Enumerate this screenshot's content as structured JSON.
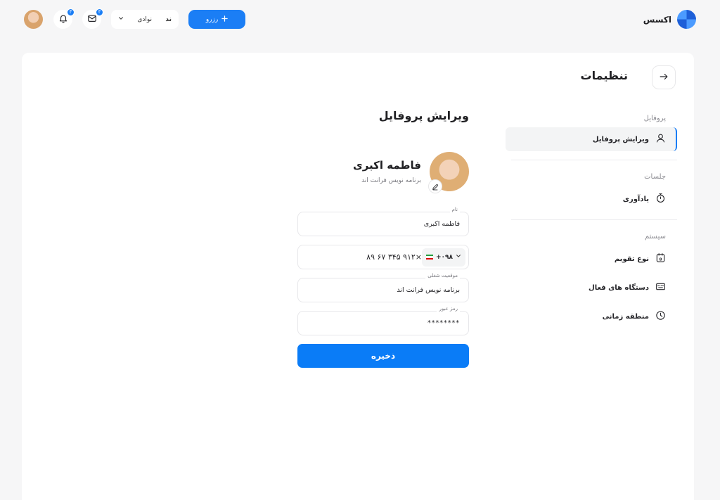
{
  "app": {
    "brand_name": "اکسس"
  },
  "topbar": {
    "reserve_label": "رزرو",
    "language": {
      "tag": "ﻧﺪ",
      "label": "نوادی"
    },
    "messages_badge": "۳",
    "notifications_badge": "۳"
  },
  "page": {
    "title": "تنظیمات"
  },
  "sidebar": {
    "sections": [
      {
        "title": "پروفایل",
        "items": [
          {
            "label": "ویرایش پروفایل",
            "icon": "user-icon"
          }
        ]
      },
      {
        "title": "جلسات",
        "items": [
          {
            "label": "یادآوری",
            "icon": "stopwatch-icon"
          }
        ]
      },
      {
        "title": "سیستم",
        "items": [
          {
            "label": "نوع تقویم",
            "icon": "calendar-icon"
          },
          {
            "label": "دستگاه های فعال",
            "icon": "keyboard-icon"
          },
          {
            "label": "منطقه زمانی",
            "icon": "clock-icon"
          }
        ]
      }
    ]
  },
  "profile": {
    "section_title": "ویرایش پروفایل",
    "name": "فاطمه اکبری",
    "role": "برنامه نویس فرانت اند"
  },
  "form": {
    "name_label": "نام",
    "name_value": "فاطمه اکبری",
    "phone_value": "۹۱۲ ۳۴۵ ۶۷ ۸۹",
    "country_code": "۰۹۸+",
    "job_label": "موقعیت شغلی",
    "job_value": "برنامه نویس فرانت اند",
    "password_label": "رمز عبور",
    "password_value": "********",
    "save_label": "ذخیره"
  },
  "colors": {
    "accent": "#1b7ef5",
    "page_bg": "#f6f6f7",
    "card_bg": "#ffffff"
  }
}
